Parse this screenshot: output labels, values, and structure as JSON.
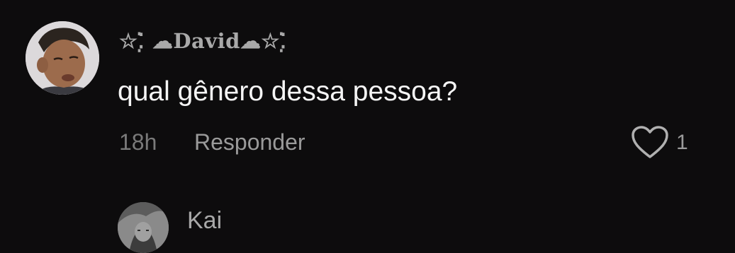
{
  "comment": {
    "username": "☆⁚̣̇ ☁David☁☆⁚̣̇",
    "text": "qual gênero dessa pessoa?",
    "timestamp": "18h",
    "reply_label": "Responder",
    "like_count": "1",
    "like_icon": "heart-outline-icon"
  },
  "reply": {
    "username": "Kai"
  },
  "colors": {
    "background": "#0d0c0d",
    "primary_text": "#f5f5f5",
    "secondary_text": "#9a9a9a",
    "muted_text": "#7a7a7a"
  }
}
